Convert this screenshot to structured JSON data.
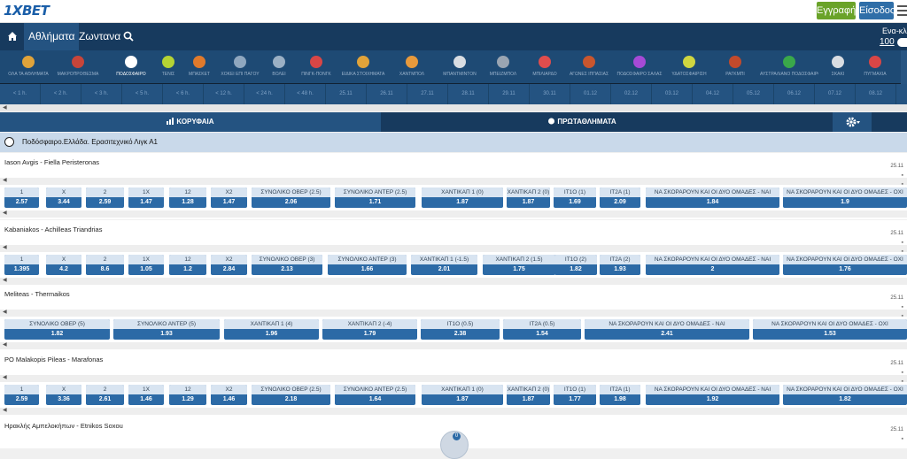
{
  "header": {
    "logo": "1XBET",
    "register_label": "Εγγραφή",
    "login_label": "Είσοδος"
  },
  "nav": {
    "sports_label": "Αθλήματα",
    "live_label": "Ζωντανα",
    "one_click_label": "Ενα-κλ",
    "one_click_value": "100"
  },
  "sports": [
    {
      "label": "ΟΛΑ ΤΑ ΑΘΛΗΜΑΤΑ",
      "color": "#e0a33a"
    },
    {
      "label": "ΜΑΚΡΟΠΡΟΘΕΣΜΑ",
      "color": "#c8453a"
    },
    {
      "label": "ΠΟΔΟΣΦΑΙΡΟ",
      "color": "#ffffff"
    },
    {
      "label": "ΤΕΝΙΣ",
      "color": "#b5d334"
    },
    {
      "label": "ΜΠΑΣΚΕΤ",
      "color": "#e07a2c"
    },
    {
      "label": "ΧΟΚΕΙ ΕΠΙ ΠΑΓΟΥ",
      "color": "#8fa7bf"
    },
    {
      "label": "ΒΟΛΕΪ",
      "color": "#9bb0c4"
    },
    {
      "label": "ΠΙΝΓΚ-ΠΟΝΓΚ",
      "color": "#d84646"
    },
    {
      "label": "ΕΙΔΙΚΑ ΣΤΟΙΧΗΜΑΤΑ",
      "color": "#e0a33a"
    },
    {
      "label": "ΧΑΝΤΜΠΟΛ",
      "color": "#e89a3c"
    },
    {
      "label": "ΜΠΑΝΤΜΙΝΤΟΝ",
      "color": "#d9dde2"
    },
    {
      "label": "ΜΠΕΪΖΜΠΟΛ",
      "color": "#9aa5b2"
    },
    {
      "label": "ΜΠΙΛΙΑΡΔΟ",
      "color": "#e04d4d"
    },
    {
      "label": "ΑΓΩΝΕΣ ΙΠΠΑΣΙΑΣ",
      "color": "#c9562e"
    },
    {
      "label": "ΠΟΔΟΣΦΑΙΡΟ ΣΑΛΑΣ",
      "color": "#a64ad6"
    },
    {
      "label": "ΥΔΑΤΟΣΦΑΙΡΙΣΗ",
      "color": "#cfd640"
    },
    {
      "label": "ΡΑΓΚΜΠΙ",
      "color": "#c24a2c"
    },
    {
      "label": "ΑΥΣΤΡΑΛΙΑΝΟ ΠΟΔΟΣΦΑΙΡΟ",
      "color": "#3aa84a"
    },
    {
      "label": "ΣΚΑΚΙ",
      "color": "#d9dde2"
    },
    {
      "label": "ΠΥΓΜΑΧΙΑ",
      "color": "#d84646"
    }
  ],
  "time_filters": [
    "< 1 h.",
    "< 2 h.",
    "< 3 h.",
    "< 5 h.",
    "< 6 h.",
    "< 12 h.",
    "< 24 h.",
    "< 48 h.",
    "25.11",
    "26.11",
    "27.11",
    "28.11",
    "29.11",
    "30.11",
    "01.12",
    "02.12",
    "03.12",
    "04.12",
    "05.12",
    "06.12",
    "07.12",
    "08.12"
  ],
  "tabs": {
    "top_label": "ΚΟΡΥΦΑΙΑ",
    "championships_label": "ΠΡΩΤΑΘΛΗΜΑΤΑ"
  },
  "league": {
    "title": "Ποδόσφαιρο.Ελλάδα. Ερασιτεχνικό Λιγκ Α1"
  },
  "events": [
    {
      "teams": "Iason Avgis - Fiella Peristeronas",
      "date": "25.11",
      "markets": [
        {
          "h": "1",
          "v": "2.57"
        },
        {
          "h": "X",
          "v": "3.44"
        },
        {
          "h": "2",
          "v": "2.59"
        },
        {
          "h": "1X",
          "v": "1.47"
        },
        {
          "h": "12",
          "v": "1.28"
        },
        {
          "h": "X2",
          "v": "1.47"
        },
        {
          "h": "ΣΥΝΟΛΙΚΟ ΟΒΕΡ (2.5)",
          "v": "2.06"
        },
        {
          "h": "ΣΥΝΟΛΙΚΟ ΑΝΤΕΡ (2.5)",
          "v": "1.71"
        },
        {
          "h": "ΧΑΝΤΙΚΑΠ 1 (0)",
          "v": "1.87"
        },
        {
          "h": "ΧΑΝΤΙΚΑΠ 2 (0)",
          "v": "1.87"
        },
        {
          "h": "IT1O (1)",
          "v": "1.69"
        },
        {
          "h": "IT2A (1)",
          "v": "2.09"
        },
        {
          "h": "ΝΑ ΣΚΟΡΑΡΟΥΝ ΚΑΙ ΟΙ ΔΥΟ ΟΜΑΔΕΣ - ΝΑΙ",
          "v": "1.84"
        },
        {
          "h": "ΝΑ ΣΚΟΡΑΡΟΥΝ ΚΑΙ ΟΙ ΔΥΟ ΟΜΑΔΕΣ - ΟΧΙ",
          "v": "1.9"
        }
      ]
    },
    {
      "teams": "Kabaniakos - Achilleas Triandrias",
      "date": "25.11",
      "markets": [
        {
          "h": "1",
          "v": "1.395"
        },
        {
          "h": "X",
          "v": "4.2"
        },
        {
          "h": "2",
          "v": "8.6"
        },
        {
          "h": "1X",
          "v": "1.05"
        },
        {
          "h": "12",
          "v": "1.2"
        },
        {
          "h": "X2",
          "v": "2.84"
        },
        {
          "h": "ΣΥΝΟΛΙΚΟ ΟΒΕΡ (3)",
          "v": "2.13"
        },
        {
          "h": "ΣΥΝΟΛΙΚΟ ΑΝΤΕΡ (3)",
          "v": "1.66"
        },
        {
          "h": "ΧΑΝΤΙΚΑΠ 1 (-1.5)",
          "v": "2.01"
        },
        {
          "h": "ΧΑΝΤΙΚΑΠ 2 (1.5)",
          "v": "1.75"
        },
        {
          "h": "IT1O (2)",
          "v": "1.82"
        },
        {
          "h": "IT2A (2)",
          "v": "1.93"
        },
        {
          "h": "ΝΑ ΣΚΟΡΑΡΟΥΝ ΚΑΙ ΟΙ ΔΥΟ ΟΜΑΔΕΣ - ΝΑΙ",
          "v": "2"
        },
        {
          "h": "ΝΑ ΣΚΟΡΑΡΟΥΝ ΚΑΙ ΟΙ ΔΥΟ ΟΜΑΔΕΣ - ΟΧΙ",
          "v": "1.76"
        }
      ]
    },
    {
      "teams": "Meliteas - Thermaikos",
      "date": "25.11",
      "markets": [
        {
          "h": "ΣΥΝΟΛΙΚΟ ΟΒΕΡ (5)",
          "v": "1.82"
        },
        {
          "h": "ΣΥΝΟΛΙΚΟ ΑΝΤΕΡ (5)",
          "v": "1.93"
        },
        {
          "h": "ΧΑΝΤΙΚΑΠ 1 (4)",
          "v": "1.96"
        },
        {
          "h": "ΧΑΝΤΙΚΑΠ 2 (-4)",
          "v": "1.79"
        },
        {
          "h": "IT1O (0.5)",
          "v": "2.38"
        },
        {
          "h": "IT2A (0.5)",
          "v": "1.54"
        },
        {
          "h": "ΝΑ ΣΚΟΡΑΡΟΥΝ ΚΑΙ ΟΙ ΔΥΟ ΟΜΑΔΕΣ - ΝΑΙ",
          "v": "2.41"
        },
        {
          "h": "ΝΑ ΣΚΟΡΑΡΟΥΝ ΚΑΙ ΟΙ ΔΥΟ ΟΜΑΔΕΣ - ΟΧΙ",
          "v": "1.53"
        }
      ]
    },
    {
      "teams": "PO Malakopis Pileas - Marafonas",
      "date": "25.11",
      "markets": [
        {
          "h": "1",
          "v": "2.59"
        },
        {
          "h": "X",
          "v": "3.36"
        },
        {
          "h": "2",
          "v": "2.61"
        },
        {
          "h": "1X",
          "v": "1.46"
        },
        {
          "h": "12",
          "v": "1.29"
        },
        {
          "h": "X2",
          "v": "1.46"
        },
        {
          "h": "ΣΥΝΟΛΙΚΟ ΟΒΕΡ (2.5)",
          "v": "2.18"
        },
        {
          "h": "ΣΥΝΟΛΙΚΟ ΑΝΤΕΡ (2.5)",
          "v": "1.64"
        },
        {
          "h": "ΧΑΝΤΙΚΑΠ 1 (0)",
          "v": "1.87"
        },
        {
          "h": "ΧΑΝΤΙΚΑΠ 2 (0)",
          "v": "1.87"
        },
        {
          "h": "IT1O (1)",
          "v": "1.77"
        },
        {
          "h": "IT2A (1)",
          "v": "1.98"
        },
        {
          "h": "ΝΑ ΣΚΟΡΑΡΟΥΝ ΚΑΙ ΟΙ ΔΥΟ ΟΜΑΔΕΣ - ΝΑΙ",
          "v": "1.92"
        },
        {
          "h": "ΝΑ ΣΚΟΡΑΡΟΥΝ ΚΑΙ ΟΙ ΔΥΟ ΟΜΑΔΕΣ - ΟΧΙ",
          "v": "1.82"
        }
      ]
    },
    {
      "teams": "Ηρακλής Αμπελοκήπων - Etnikos Soxou",
      "date": "25.11",
      "markets": []
    }
  ],
  "coupon": {
    "badge": "0"
  }
}
